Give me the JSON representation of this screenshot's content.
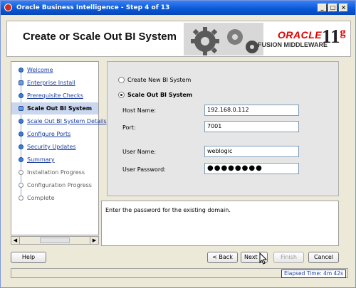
{
  "window": {
    "title": "Oracle Business Intelligence - Step 4 of 13",
    "min": "_",
    "max": "□",
    "close": "×"
  },
  "header": {
    "title": "Create or Scale Out BI System",
    "brand": "ORACLE",
    "product": "FUSION MIDDLEWARE",
    "version_number": "11",
    "version_letter": "g"
  },
  "nav": {
    "items": [
      {
        "label": "Welcome",
        "state": "link"
      },
      {
        "label": "Enterprise Install",
        "state": "link"
      },
      {
        "label": "Prerequisite Checks",
        "state": "link"
      },
      {
        "label": "Scale Out BI System",
        "state": "current"
      },
      {
        "label": "Scale Out BI System Details",
        "state": "link"
      },
      {
        "label": "Configure Ports",
        "state": "link"
      },
      {
        "label": "Security Updates",
        "state": "link"
      },
      {
        "label": "Summary",
        "state": "link"
      },
      {
        "label": "Installation Progress",
        "state": "disabled"
      },
      {
        "label": "Configuration Progress",
        "state": "disabled"
      },
      {
        "label": "Complete",
        "state": "disabled"
      }
    ]
  },
  "form": {
    "option_create": "Create New BI System",
    "option_scale": "Scale Out BI System",
    "host_label": "Host Name:",
    "host_value": "192.168.0.112",
    "port_label": "Port:",
    "port_value": "7001",
    "user_label": "User Name:",
    "user_value": "weblogic",
    "password_label": "User Password:",
    "password_value": "●●●●●●●●"
  },
  "message": "Enter the password for the existing domain.",
  "buttons": {
    "help": "Help",
    "back": "< Back",
    "next": "Next >",
    "finish": "Finish",
    "cancel": "Cancel"
  },
  "status": {
    "elapsed": "Elapsed Time: 4m 42s"
  },
  "colors": {
    "titlebar": "#0a5ad8",
    "oracle_red": "#e00000",
    "link": "#1c3fa0",
    "current_step_bg": "#cad7ef"
  }
}
